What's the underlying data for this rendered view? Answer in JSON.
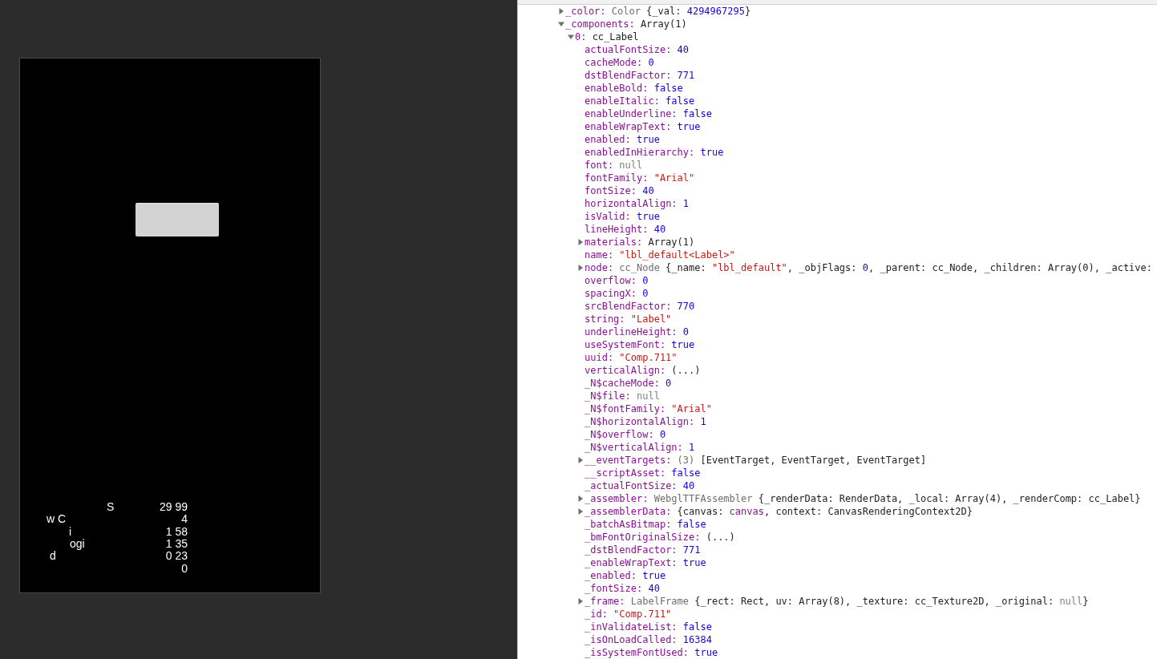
{
  "game_view": {
    "button": {
      "kind": "blank"
    },
    "stats": [
      {
        "label": "S",
        "value": "29 99"
      },
      {
        "label": "w C",
        "value": "4"
      },
      {
        "label": "i",
        "value": "1 58"
      },
      {
        "label": "ogi",
        "value": "1 35"
      },
      {
        "label": "d",
        "value": "0 23"
      },
      {
        "value": "0"
      }
    ]
  },
  "inspector": {
    "tree": [
      {
        "key": "_color:",
        "kind": "expandable",
        "expanded": false,
        "value": [
          {
            "text": "Color",
            "kind": "type"
          },
          {
            "text": " {_val: ",
            "kind": "plain"
          },
          {
            "text": "4294967295",
            "kind": "num"
          },
          {
            "text": "}",
            "kind": "plain"
          }
        ]
      },
      {
        "key": "_components:",
        "kind": "expandable",
        "expanded": true,
        "value": [
          {
            "text": "Array(1)",
            "kind": "plain"
          }
        ],
        "children": [
          {
            "key": "0:",
            "kind": "expandable",
            "expanded": true,
            "value": [
              {
                "text": "cc_Label",
                "kind": "plain"
              }
            ],
            "children": [
              {
                "key": "actualFontSize:",
                "kind": "leaf",
                "value": [
                  {
                    "text": "40",
                    "kind": "num"
                  }
                ]
              },
              {
                "key": "cacheMode:",
                "kind": "leaf",
                "value": [
                  {
                    "text": "0",
                    "kind": "num"
                  }
                ]
              },
              {
                "key": "dstBlendFactor:",
                "kind": "leaf",
                "value": [
                  {
                    "text": "771",
                    "kind": "num"
                  }
                ]
              },
              {
                "key": "enableBold:",
                "kind": "leaf",
                "value": [
                  {
                    "text": "false",
                    "kind": "kw"
                  }
                ]
              },
              {
                "key": "enableItalic:",
                "kind": "leaf",
                "value": [
                  {
                    "text": "false",
                    "kind": "kw"
                  }
                ]
              },
              {
                "key": "enableUnderline:",
                "kind": "leaf",
                "value": [
                  {
                    "text": "false",
                    "kind": "kw"
                  }
                ]
              },
              {
                "key": "enableWrapText:",
                "kind": "leaf",
                "value": [
                  {
                    "text": "true",
                    "kind": "kw"
                  }
                ]
              },
              {
                "key": "enabled:",
                "kind": "leaf",
                "value": [
                  {
                    "text": "true",
                    "kind": "kw"
                  }
                ]
              },
              {
                "key": "enabledInHierarchy:",
                "kind": "leaf",
                "value": [
                  {
                    "text": "true",
                    "kind": "kw"
                  }
                ]
              },
              {
                "key": "font:",
                "kind": "leaf",
                "value": [
                  {
                    "text": "null",
                    "kind": "null"
                  }
                ]
              },
              {
                "key": "fontFamily:",
                "kind": "leaf",
                "value": [
                  {
                    "text": "\"Arial\"",
                    "kind": "str"
                  }
                ]
              },
              {
                "key": "fontSize:",
                "kind": "leaf",
                "value": [
                  {
                    "text": "40",
                    "kind": "num"
                  }
                ]
              },
              {
                "key": "horizontalAlign:",
                "kind": "leaf",
                "value": [
                  {
                    "text": "1",
                    "kind": "num"
                  }
                ]
              },
              {
                "key": "isValid:",
                "kind": "leaf",
                "value": [
                  {
                    "text": "true",
                    "kind": "kw"
                  }
                ]
              },
              {
                "key": "lineHeight:",
                "kind": "leaf",
                "value": [
                  {
                    "text": "40",
                    "kind": "num"
                  }
                ]
              },
              {
                "key": "materials:",
                "kind": "expandable",
                "expanded": false,
                "value": [
                  {
                    "text": "Array(1)",
                    "kind": "plain"
                  }
                ]
              },
              {
                "key": "name:",
                "kind": "leaf",
                "value": [
                  {
                    "text": "\"lbl_default<Label>\"",
                    "kind": "str"
                  }
                ]
              },
              {
                "key": "node:",
                "kind": "expandable",
                "expanded": false,
                "value": [
                  {
                    "text": "cc_Node",
                    "kind": "type"
                  },
                  {
                    "text": " {_name: ",
                    "kind": "plain"
                  },
                  {
                    "text": "\"lbl_default\"",
                    "kind": "str"
                  },
                  {
                    "text": ", _objFlags: ",
                    "kind": "plain"
                  },
                  {
                    "text": "0",
                    "kind": "num"
                  },
                  {
                    "text": ", _parent: cc_Node, _children: Array(0), _active:",
                    "kind": "plain"
                  }
                ]
              },
              {
                "key": "overflow:",
                "kind": "leaf",
                "value": [
                  {
                    "text": "0",
                    "kind": "num"
                  }
                ]
              },
              {
                "key": "spacingX:",
                "kind": "leaf",
                "value": [
                  {
                    "text": "0",
                    "kind": "num"
                  }
                ]
              },
              {
                "key": "srcBlendFactor:",
                "kind": "leaf",
                "value": [
                  {
                    "text": "770",
                    "kind": "num"
                  }
                ]
              },
              {
                "key": "string:",
                "kind": "leaf",
                "value": [
                  {
                    "text": "\"Label\"",
                    "kind": "str"
                  }
                ]
              },
              {
                "key": "underlineHeight:",
                "kind": "leaf",
                "value": [
                  {
                    "text": "0",
                    "kind": "num"
                  }
                ]
              },
              {
                "key": "useSystemFont:",
                "kind": "leaf",
                "value": [
                  {
                    "text": "true",
                    "kind": "kw"
                  }
                ]
              },
              {
                "key": "uuid:",
                "kind": "leaf",
                "value": [
                  {
                    "text": "\"Comp.711\"",
                    "kind": "str"
                  }
                ]
              },
              {
                "key": "verticalAlign:",
                "kind": "leaf",
                "value": [
                  {
                    "text": "(...)",
                    "kind": "plain"
                  }
                ]
              },
              {
                "key": "_N$cacheMode:",
                "kind": "leaf",
                "value": [
                  {
                    "text": "0",
                    "kind": "num"
                  }
                ]
              },
              {
                "key": "_N$file:",
                "kind": "leaf",
                "value": [
                  {
                    "text": "null",
                    "kind": "null"
                  }
                ]
              },
              {
                "key": "_N$fontFamily:",
                "kind": "leaf",
                "value": [
                  {
                    "text": "\"Arial\"",
                    "kind": "str"
                  }
                ]
              },
              {
                "key": "_N$horizontalAlign:",
                "kind": "leaf",
                "value": [
                  {
                    "text": "1",
                    "kind": "num"
                  }
                ]
              },
              {
                "key": "_N$overflow:",
                "kind": "leaf",
                "value": [
                  {
                    "text": "0",
                    "kind": "num"
                  }
                ]
              },
              {
                "key": "_N$verticalAlign:",
                "kind": "leaf",
                "value": [
                  {
                    "text": "1",
                    "kind": "num"
                  }
                ]
              },
              {
                "key": "__eventTargets:",
                "kind": "expandable",
                "expanded": false,
                "value": [
                  {
                    "text": "(3)",
                    "kind": "type"
                  },
                  {
                    "text": " [EventTarget, EventTarget, EventTarget]",
                    "kind": "plain"
                  }
                ]
              },
              {
                "key": "__scriptAsset:",
                "kind": "leaf",
                "value": [
                  {
                    "text": "false",
                    "kind": "kw"
                  }
                ]
              },
              {
                "key": "_actualFontSize:",
                "kind": "leaf",
                "value": [
                  {
                    "text": "40",
                    "kind": "num"
                  }
                ]
              },
              {
                "key": "_assembler:",
                "kind": "expandable",
                "expanded": false,
                "value": [
                  {
                    "text": "WebglTTFAssembler",
                    "kind": "type"
                  },
                  {
                    "text": " {_renderData: RenderData, _local: Array(4), _renderComp: cc_Label}",
                    "kind": "plain"
                  }
                ]
              },
              {
                "key": "_assemblerData:",
                "kind": "expandable",
                "expanded": false,
                "value": [
                  {
                    "text": "{canvas: ",
                    "kind": "plain"
                  },
                  {
                    "text": "canvas",
                    "kind": "ref"
                  },
                  {
                    "text": ", context: CanvasRenderingContext2D}",
                    "kind": "plain"
                  }
                ]
              },
              {
                "key": "_batchAsBitmap:",
                "kind": "leaf",
                "value": [
                  {
                    "text": "false",
                    "kind": "kw"
                  }
                ]
              },
              {
                "key": "_bmFontOriginalSize:",
                "kind": "leaf",
                "value": [
                  {
                    "text": "(...)",
                    "kind": "plain"
                  }
                ]
              },
              {
                "key": "_dstBlendFactor:",
                "kind": "leaf",
                "value": [
                  {
                    "text": "771",
                    "kind": "num"
                  }
                ]
              },
              {
                "key": "_enableWrapText:",
                "kind": "leaf",
                "value": [
                  {
                    "text": "true",
                    "kind": "kw"
                  }
                ]
              },
              {
                "key": "_enabled:",
                "kind": "leaf",
                "value": [
                  {
                    "text": "true",
                    "kind": "kw"
                  }
                ]
              },
              {
                "key": "_fontSize:",
                "kind": "leaf",
                "value": [
                  {
                    "text": "40",
                    "kind": "num"
                  }
                ]
              },
              {
                "key": "_frame:",
                "kind": "expandable",
                "expanded": false,
                "value": [
                  {
                    "text": "LabelFrame",
                    "kind": "type"
                  },
                  {
                    "text": " {_rect: Rect, uv: Array(8), _texture: cc_Texture2D, _original: ",
                    "kind": "plain"
                  },
                  {
                    "text": "null",
                    "kind": "null"
                  },
                  {
                    "text": "}",
                    "kind": "plain"
                  }
                ]
              },
              {
                "key": "_id:",
                "kind": "leaf",
                "value": [
                  {
                    "text": "\"Comp.711\"",
                    "kind": "str"
                  }
                ]
              },
              {
                "key": "_inValidateList:",
                "kind": "leaf",
                "value": [
                  {
                    "text": "false",
                    "kind": "kw"
                  }
                ]
              },
              {
                "key": "_isOnLoadCalled:",
                "kind": "leaf",
                "value": [
                  {
                    "text": "16384",
                    "kind": "num"
                  }
                ]
              },
              {
                "key": "_isSystemFontUsed:",
                "kind": "leaf",
                "value": [
                  {
                    "text": "true",
                    "kind": "kw"
                  }
                ]
              }
            ]
          }
        ]
      }
    ]
  }
}
